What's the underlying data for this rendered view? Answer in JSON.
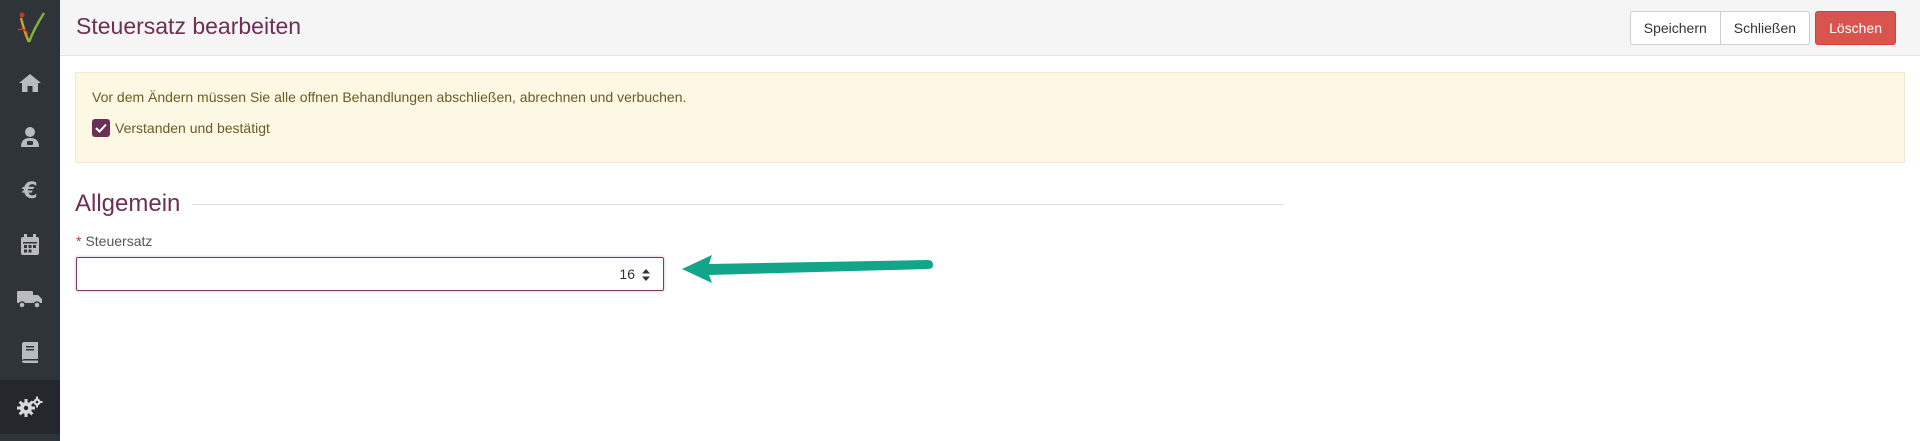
{
  "page": {
    "title": "Steuersatz bearbeiten"
  },
  "toolbar": {
    "save_label": "Speichern",
    "close_label": "Schließen",
    "delete_label": "Löschen"
  },
  "sidebar": {
    "items": [
      {
        "icon": "home-icon"
      },
      {
        "icon": "patient-icon"
      },
      {
        "icon": "euro-icon",
        "glyph": "€"
      },
      {
        "icon": "calendar-icon"
      },
      {
        "icon": "truck-icon"
      },
      {
        "icon": "book-icon"
      },
      {
        "icon": "settings-icon",
        "active": true
      }
    ]
  },
  "alert": {
    "message": "Vor dem Ändern müssen Sie alle offnen Behandlungen abschließen, abrechnen und verbuchen.",
    "checkbox_label": "Verstanden und bestätigt",
    "checked": true
  },
  "section": {
    "title": "Allgemein"
  },
  "field": {
    "required_marker": "*",
    "label": "Steuersatz",
    "value": "16"
  },
  "colors": {
    "brand": "#6d2f55",
    "sidebar": "#2f3439",
    "danger": "#d9534f",
    "alert_bg": "#fcf8e3",
    "annotation_arrow": "#13a58a"
  }
}
